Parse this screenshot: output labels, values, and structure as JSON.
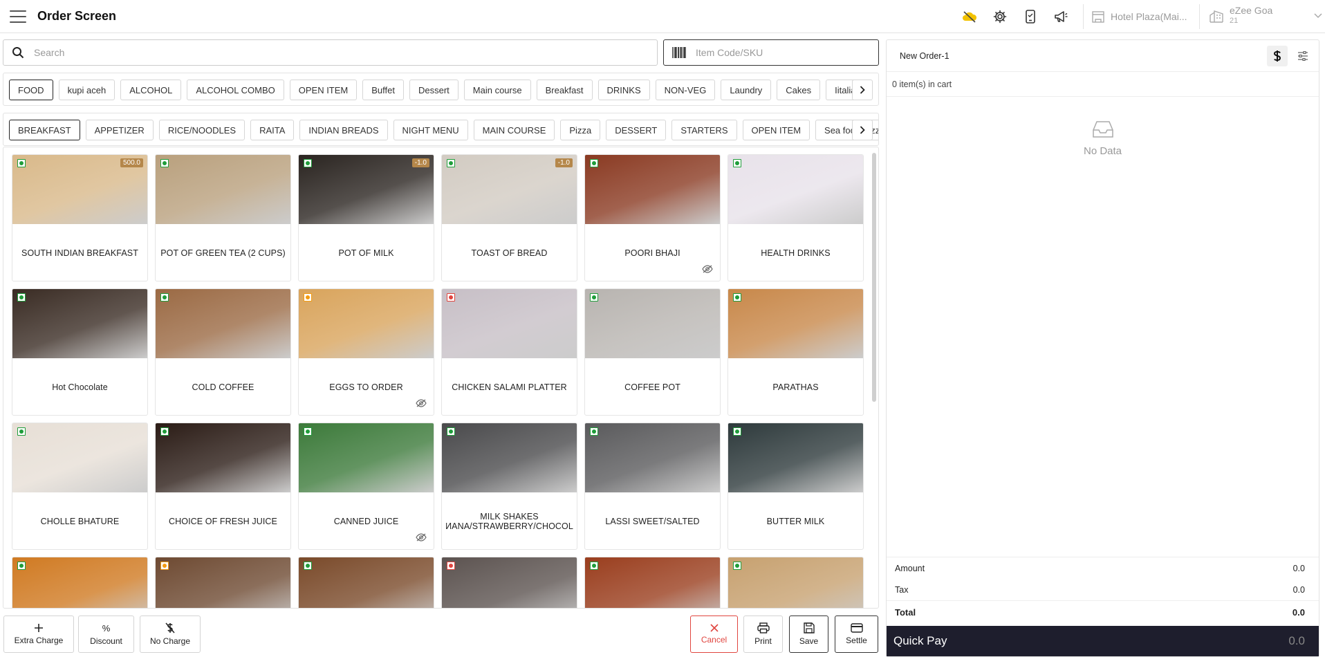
{
  "header": {
    "title": "Order Screen",
    "property_name": "Hotel Plaza(Mai...",
    "company_name": "eZee Goa",
    "company_sub": "21"
  },
  "search": {
    "placeholder": "Search",
    "sku_placeholder": "Item Code/SKU"
  },
  "categories": [
    {
      "label": "FOOD",
      "active": true
    },
    {
      "label": "kupi aceh"
    },
    {
      "label": "ALCOHOL"
    },
    {
      "label": "ALCOHOL COMBO"
    },
    {
      "label": "OPEN ITEM"
    },
    {
      "label": "Buffet"
    },
    {
      "label": "Dessert"
    },
    {
      "label": "Main course"
    },
    {
      "label": "Breakfast"
    },
    {
      "label": "DRINKS"
    },
    {
      "label": "NON-VEG"
    },
    {
      "label": "Laundry"
    },
    {
      "label": "Cakes"
    },
    {
      "label": "Iitalian"
    }
  ],
  "subcategories": [
    {
      "label": "BREAKFAST",
      "active": true
    },
    {
      "label": "APPETIZER"
    },
    {
      "label": "RICE/NOODLES"
    },
    {
      "label": "RAITA"
    },
    {
      "label": "INDIAN BREADS"
    },
    {
      "label": "NIGHT MENU"
    },
    {
      "label": "MAIN COURSE"
    },
    {
      "label": "Pizza"
    },
    {
      "label": "DESSERT"
    },
    {
      "label": "STARTERS"
    },
    {
      "label": "OPEN ITEM"
    },
    {
      "label": "Sea food Sizzler"
    }
  ],
  "items": [
    {
      "name": "SOUTH INDIAN BREAKFAST",
      "type": "veg",
      "badge": "500.0",
      "bg": "#d9b98a",
      "hidden": false
    },
    {
      "name": "POT OF GREEN TEA (2 CUPS)",
      "type": "veg",
      "badge": "",
      "bg": "#b9a07d",
      "hidden": false
    },
    {
      "name": "POT OF MILK",
      "type": "veg",
      "badge": "-1.0",
      "bg": "#2a2420",
      "hidden": false
    },
    {
      "name": "TOAST OF BREAD",
      "type": "veg",
      "badge": "-1.0",
      "bg": "#d2cbc2",
      "hidden": false
    },
    {
      "name": "POORI BHAJI",
      "type": "veg",
      "badge": "",
      "bg": "#8a3a22",
      "hidden": true
    },
    {
      "name": "HEALTH DRINKS",
      "type": "veg",
      "badge": "",
      "bg": "#e8e2ea",
      "hidden": false
    },
    {
      "name": "Hot Chocolate",
      "type": "veg",
      "badge": "",
      "bg": "#3a2c24",
      "hidden": false
    },
    {
      "name": "COLD COFFEE",
      "type": "veg",
      "badge": "",
      "bg": "#9b6a44",
      "hidden": false
    },
    {
      "name": "EGGS TO ORDER",
      "type": "egg",
      "badge": "",
      "bg": "#d9a45c",
      "hidden": true
    },
    {
      "name": "CHICKEN SALAMI PLATTER",
      "type": "nonveg",
      "badge": "",
      "bg": "#c7bfc6",
      "hidden": false
    },
    {
      "name": "COFFEE POT",
      "type": "veg",
      "badge": "",
      "bg": "#b8b4b0",
      "hidden": false
    },
    {
      "name": "PARATHAS",
      "type": "veg",
      "badge": "",
      "bg": "#c8884a",
      "hidden": false
    },
    {
      "name": "CHOLLE BHATURE",
      "type": "veg",
      "badge": "",
      "bg": "#e7dfd6",
      "hidden": false
    },
    {
      "name": "CHOICE OF FRESH JUICE",
      "type": "veg",
      "badge": "",
      "bg": "#2b1c16",
      "hidden": false
    },
    {
      "name": "CANNED JUICE",
      "type": "veg",
      "badge": "",
      "bg": "#3c7a3a",
      "hidden": true
    },
    {
      "name": "MILK SHAKES\nИANA/STRAWBERRY/CHOCOL",
      "type": "veg",
      "badge": "",
      "bg": "#4a4a4c",
      "hidden": false
    },
    {
      "name": "LASSI SWEET/SALTED",
      "type": "veg",
      "badge": "",
      "bg": "#5a5a5c",
      "hidden": false
    },
    {
      "name": "BUTTER MILK",
      "type": "veg",
      "badge": "",
      "bg": "#2e3a3c",
      "hidden": false
    },
    {
      "name": "",
      "type": "veg",
      "badge": "",
      "bg": "#d07a22",
      "hidden": false
    },
    {
      "name": "",
      "type": "egg",
      "badge": "",
      "bg": "#6e4a32",
      "hidden": false
    },
    {
      "name": "",
      "type": "veg",
      "badge": "",
      "bg": "#7a4a2a",
      "hidden": false
    },
    {
      "name": "",
      "type": "nonveg",
      "badge": "",
      "bg": "#5c5350",
      "hidden": false
    },
    {
      "name": "",
      "type": "veg",
      "badge": "",
      "bg": "#9a3e1e",
      "hidden": false
    },
    {
      "name": "",
      "type": "veg",
      "badge": "",
      "bg": "#c7a170",
      "hidden": false
    }
  ],
  "footer": {
    "extra_charge": "Extra Charge",
    "discount": "Discount",
    "no_charge": "No Charge",
    "cancel": "Cancel",
    "print": "Print",
    "save": "Save",
    "settle": "Settle"
  },
  "cart": {
    "order_name": "New Order-1",
    "count_text": "0 item(s) in cart",
    "empty_text": "No Data",
    "amount_label": "Amount",
    "amount_value": "0.0",
    "tax_label": "Tax",
    "tax_value": "0.0",
    "total_label": "Total",
    "total_value": "0.0",
    "quickpay_label": "Quick Pay",
    "quickpay_value": "0.0"
  },
  "colors": {
    "veg": "#1f9d3a",
    "nonveg": "#e0443e",
    "egg": "#f39c12",
    "cancel": "#e0443e",
    "quickpay_bg": "#1e1e2d",
    "price_badge": "#b5874a"
  },
  "icons": {
    "header": [
      "menu-icon",
      "cloud-sync-icon",
      "settings-icon",
      "tablet-icon",
      "megaphone-icon",
      "building-icon",
      "company-icon",
      "chevron-down-icon"
    ],
    "search": "search-icon",
    "sku": "barcode-icon",
    "cart_tools": [
      "dollar-icon",
      "sliders-icon"
    ],
    "empty": "inbox-icon",
    "hidden": "eye-off-icon"
  }
}
